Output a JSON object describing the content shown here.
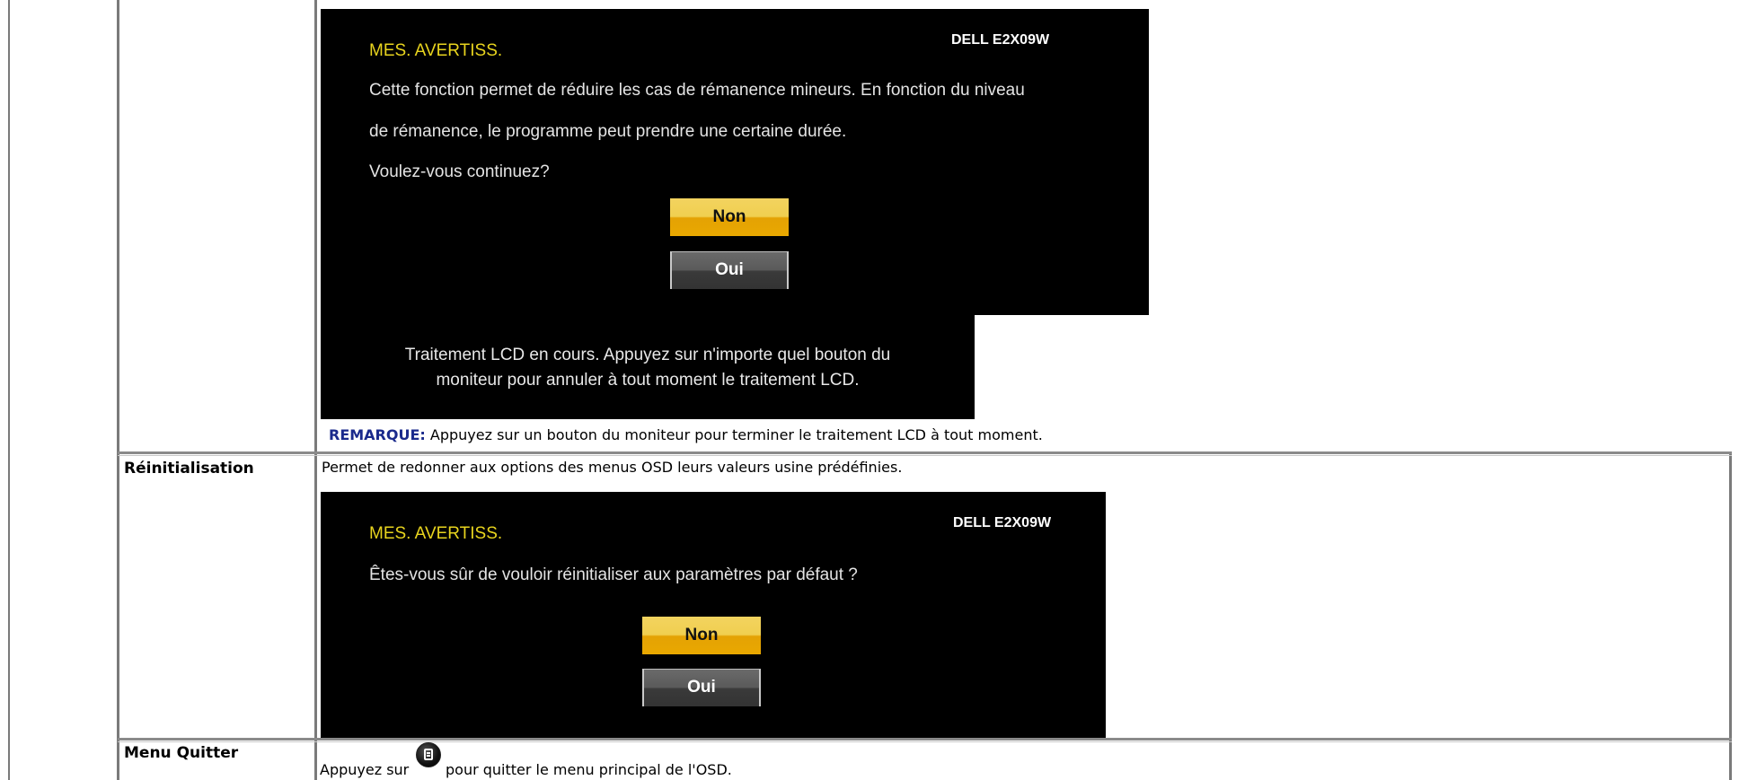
{
  "osd_lcd": {
    "title": "MES. AVERTISS.",
    "brand": "DELL E2X09W",
    "line1": "Cette fonction permet de réduire les cas de rémanence mineurs. En fonction du niveau",
    "line2": "de rémanence, le programme peut prendre une certaine durée.",
    "line3": "Voulez-vous continuez?",
    "btn_non": "Non",
    "btn_oui": "Oui"
  },
  "lcd_progress": {
    "line1": "Traitement LCD en cours. Appuyez sur n'importe quel bouton du",
    "line2": "moniteur pour annuler à tout moment le traitement LCD."
  },
  "note": {
    "label": "REMARQUE:",
    "text": " Appuyez sur un bouton du moniteur pour terminer le traitement LCD à tout moment."
  },
  "reset_row": {
    "label": "Réinitialisation",
    "description": "Permet de redonner aux options des menus OSD leurs valeurs usine prédéfinies."
  },
  "osd_reset": {
    "title": "MES. AVERTISS.",
    "brand": "DELL E2X09W",
    "question": "Êtes-vous sûr de vouloir réinitialiser aux paramètres par défaut ?",
    "btn_non": "Non",
    "btn_oui": "Oui"
  },
  "quit_row": {
    "label": "Menu Quitter",
    "text_before": "Appuyez sur",
    "text_after": "pour quitter le menu principal de l'OSD.",
    "icon": "menu-button-icon"
  },
  "colors": {
    "osd_title": "#e8d41e",
    "note_label": "#1a2a8c",
    "button_non": "#f0c020",
    "button_oui": "#4a4a4a"
  }
}
